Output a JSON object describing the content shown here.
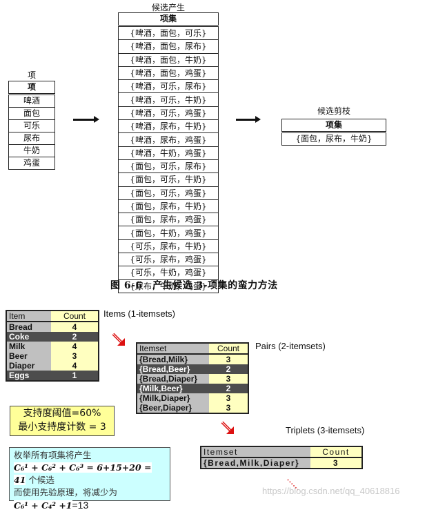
{
  "top": {
    "items_table": {
      "caption": "项",
      "header": "项",
      "rows": [
        "啤酒",
        "面包",
        "可乐",
        "尿布",
        "牛奶",
        "鸡蛋"
      ]
    },
    "candidates_table": {
      "caption": "候选产生",
      "header": "项集",
      "rows": [
        "{啤酒，面包，可乐}",
        "{啤酒，面包，尿布}",
        "{啤酒，面包，牛奶}",
        "{啤酒，面包，鸡蛋}",
        "{啤酒，可乐，尿布}",
        "{啤酒，可乐，牛奶}",
        "{啤酒，可乐，鸡蛋}",
        "{啤酒，尿布，牛奶}",
        "{啤酒，尿布，鸡蛋}",
        "{啤酒，牛奶，鸡蛋}",
        "{面包，可乐，尿布}",
        "{面包，可乐，牛奶}",
        "{面包，可乐，鸡蛋}",
        "{面包，尿布，牛奶}",
        "{面包，尿布，鸡蛋}",
        "{面包，牛奶，鸡蛋}",
        "{可乐，尿布，牛奶}",
        "{可乐，尿布，鸡蛋}",
        "{可乐，牛奶，鸡蛋}",
        "{尿布，牛奶，鸡蛋}"
      ]
    },
    "pruned_table": {
      "caption": "候选剪枝",
      "header": "项集",
      "rows": [
        "{面包，尿布，牛奶}"
      ]
    },
    "figure_caption": "图 6-6　产生候选 3-项集的蛮力方法"
  },
  "bottom": {
    "items": {
      "label": "Items (1-itemsets)",
      "header": {
        "name": "Item",
        "count": "Count"
      },
      "rows": [
        {
          "name": "Bread",
          "count": "4",
          "pruned": false
        },
        {
          "name": "Coke",
          "count": "2",
          "pruned": true
        },
        {
          "name": "Milk",
          "count": "4",
          "pruned": false
        },
        {
          "name": "Beer",
          "count": "3",
          "pruned": false
        },
        {
          "name": "Diaper",
          "count": "4",
          "pruned": false
        },
        {
          "name": "Eggs",
          "count": "1",
          "pruned": true
        }
      ]
    },
    "pairs": {
      "label": "Pairs (2-itemsets)",
      "header": {
        "name": "Itemset",
        "count": "Count"
      },
      "rows": [
        {
          "name": "{Bread,Milk}",
          "count": "3",
          "pruned": false
        },
        {
          "name": "{Bread,Beer}",
          "count": "2",
          "pruned": true
        },
        {
          "name": "{Bread,Diaper}",
          "count": "3",
          "pruned": false
        },
        {
          "name": "{Milk,Beer}",
          "count": "2",
          "pruned": true
        },
        {
          "name": "{Milk,Diaper}",
          "count": "3",
          "pruned": false
        },
        {
          "name": "{Beer,Diaper}",
          "count": "3",
          "pruned": false
        }
      ]
    },
    "triplets": {
      "label": "Triplets (3-itemsets)",
      "header": {
        "name": "Itemset",
        "count": "Count"
      },
      "rows": [
        {
          "name": "{Bread,Milk,Diaper}",
          "count": "3",
          "pruned": false
        }
      ]
    },
    "support_box": {
      "line1": "支持度阈值=60%",
      "line2": "最小支持度计数 = 3"
    },
    "enum_box": {
      "line1": "枚举所有项集将产生",
      "formula1": "C₆¹ + C₆² + C₆³ = 6+15+20 = 41",
      "line2_suffix": " 个候选",
      "line3": "而使用先验原理，将减少为",
      "formula2": "C₆¹ + C₄² +1",
      "result2": "=13"
    },
    "colors": {
      "pruned_row_bg": "#4d4d4d",
      "name_col_bg": "#c0c0c0",
      "count_col_bg": "#ffffc0",
      "support_box_bg": "#ffff99",
      "enum_box_bg": "#ccffff",
      "arrow_red": "#dd1111"
    }
  },
  "watermark": "https://blog.csdn.net/qq_40618816"
}
